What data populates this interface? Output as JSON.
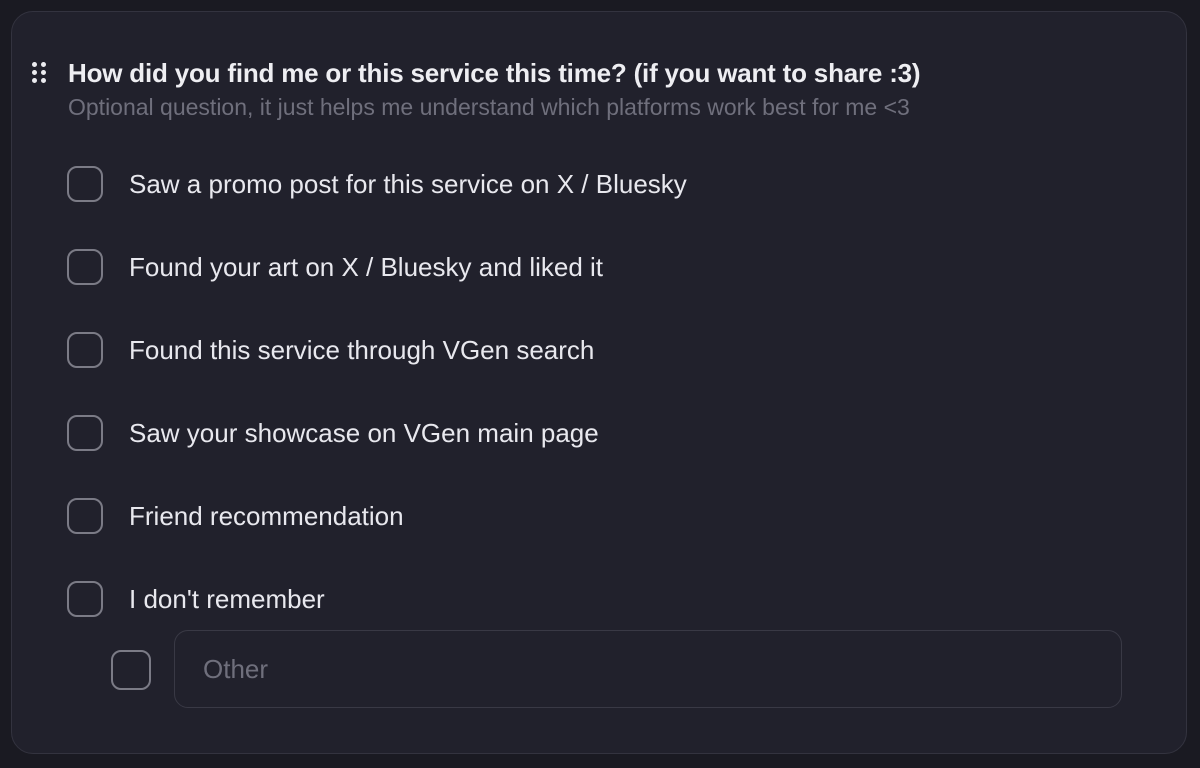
{
  "question": {
    "title": "How did you find me or this service this time? (if you want to share :3)",
    "subtitle": "Optional question, it just helps me understand which platforms work best for me <3"
  },
  "options": [
    {
      "label": "Saw a promo post for this service on X / Bluesky",
      "checked": false
    },
    {
      "label": "Found your art on X / Bluesky and liked it",
      "checked": false
    },
    {
      "label": "Found this service through VGen search",
      "checked": false
    },
    {
      "label": "Saw your showcase on VGen main page",
      "checked": false
    },
    {
      "label": "Friend recommendation",
      "checked": false
    },
    {
      "label": "I don't remember",
      "checked": false
    }
  ],
  "other": {
    "placeholder": "Other",
    "value": "",
    "checked": false
  },
  "colors": {
    "background": "#1a1a22",
    "card": "#21212c",
    "card_border": "#33333f",
    "text_primary": "#eeeef2",
    "text_muted": "#6f6f7c",
    "checkbox_border": "#7b7b86"
  },
  "icons": {
    "drag_handle": "drag-handle-icon"
  }
}
